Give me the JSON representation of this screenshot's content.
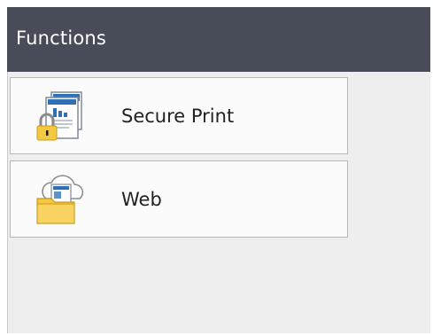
{
  "header": {
    "title": "Functions"
  },
  "items": [
    {
      "label": "Secure Print",
      "icon": "secure-print-icon"
    },
    {
      "label": "Web",
      "icon": "web-folder-icon"
    }
  ],
  "colors": {
    "header_bg": "#484b58",
    "screen_bg": "#eeeeef",
    "item_bg": "#fbfbfb",
    "folder_yellow": "#f5c842",
    "document_blue": "#2e6fb6"
  }
}
